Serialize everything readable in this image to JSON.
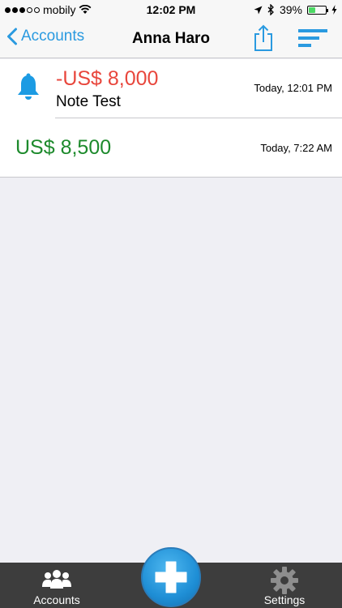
{
  "status_bar": {
    "carrier": "mobily",
    "time": "12:02 PM",
    "battery": "39%",
    "battery_level": 0.39,
    "signal_bars_filled": 3,
    "signal_bars_total": 5
  },
  "nav": {
    "back_label": "Accounts",
    "title": "Anna Haro"
  },
  "entries": [
    {
      "amount": "-US$ 8,000",
      "note": "Note Test",
      "time": "Today, 12:01 PM",
      "icon": "bell-icon",
      "color": "#e8463c"
    },
    {
      "amount": "US$ 8,500",
      "time": "Today, 7:22 AM",
      "color": "#1d8a2c"
    }
  ],
  "tab_bar": {
    "accounts_label": "Accounts",
    "settings_label": "Settings",
    "add_icon": "plus-icon"
  },
  "colors": {
    "accent": "#2a9ae0",
    "negative": "#e8463c",
    "positive": "#1d8a2c",
    "tab_bar": "#3d3d3d"
  }
}
